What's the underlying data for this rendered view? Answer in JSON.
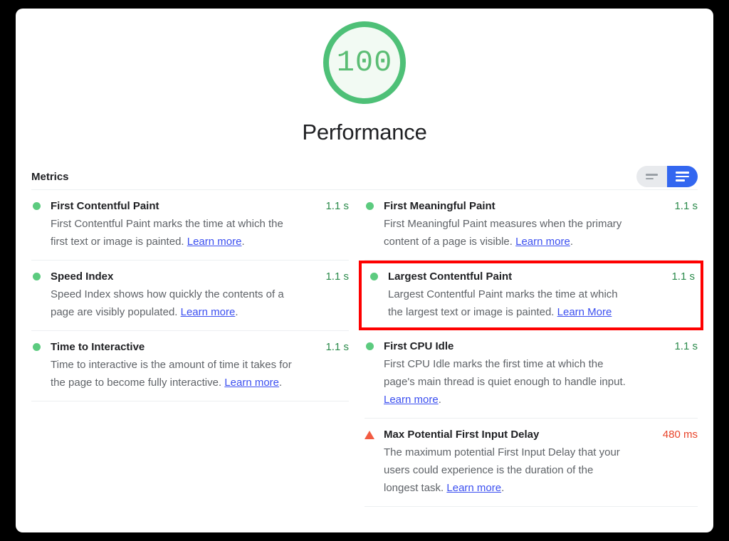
{
  "score": {
    "value": "100",
    "category_title": "Performance",
    "ring_color": "#4ec077",
    "fill_color": "#f2faf3",
    "text_color": "#5bbd74"
  },
  "metrics_section": {
    "label": "Metrics",
    "toggle": {
      "collapsed_icon": "list-compact-icon",
      "expanded_icon": "list-expanded-icon",
      "active": "expanded",
      "active_color": "#3367f0",
      "inactive_color": "#e8eaed"
    }
  },
  "columns": {
    "left": [
      {
        "icon": "status-pass-dot-icon",
        "status": "pass",
        "name": "First Contentful Paint",
        "description_before": "First Contentful Paint marks the time at which the first text or image is painted. ",
        "link_text": "Learn more",
        "description_after": ".",
        "value": "1.1 s",
        "value_state": "good"
      },
      {
        "icon": "status-pass-dot-icon",
        "status": "pass",
        "name": "Speed Index",
        "description_before": "Speed Index shows how quickly the contents of a page are visibly populated. ",
        "link_text": "Learn more",
        "description_after": ".",
        "value": "1.1 s",
        "value_state": "good"
      },
      {
        "icon": "status-pass-dot-icon",
        "status": "pass",
        "name": "Time to Interactive",
        "description_before": "Time to interactive is the amount of time it takes for the page to become fully interactive. ",
        "link_text": "Learn more",
        "description_after": ".",
        "value": "1.1 s",
        "value_state": "good"
      }
    ],
    "right": [
      {
        "icon": "status-pass-dot-icon",
        "status": "pass",
        "name": "First Meaningful Paint",
        "description_before": "First Meaningful Paint measures when the primary content of a page is visible. ",
        "link_text": "Learn more",
        "description_after": ".",
        "value": "1.1 s",
        "value_state": "good",
        "highlighted": false
      },
      {
        "icon": "status-pass-dot-icon",
        "status": "pass",
        "name": "Largest Contentful Paint",
        "description_before": "Largest Contentful Paint marks the time at which the largest text or image is painted. ",
        "link_text": "Learn More",
        "description_after": "",
        "value": "1.1 s",
        "value_state": "good",
        "highlighted": true,
        "highlight_color": "#fe0000"
      },
      {
        "icon": "status-pass-dot-icon",
        "status": "pass",
        "name": "First CPU Idle",
        "description_before": "First CPU Idle marks the first time at which the page's main thread is quiet enough to handle input. ",
        "link_text": "Learn more",
        "description_after": ".",
        "value": "1.1 s",
        "value_state": "good",
        "highlighted": false
      },
      {
        "icon": "status-warning-triangle-icon",
        "status": "warn",
        "name": "Max Potential First Input Delay",
        "description_before": "The maximum potential First Input Delay that your users could experience is the duration of the longest task. ",
        "link_text": "Learn more",
        "description_after": ".",
        "value": "480 ms",
        "value_state": "warn",
        "highlighted": false
      }
    ]
  }
}
